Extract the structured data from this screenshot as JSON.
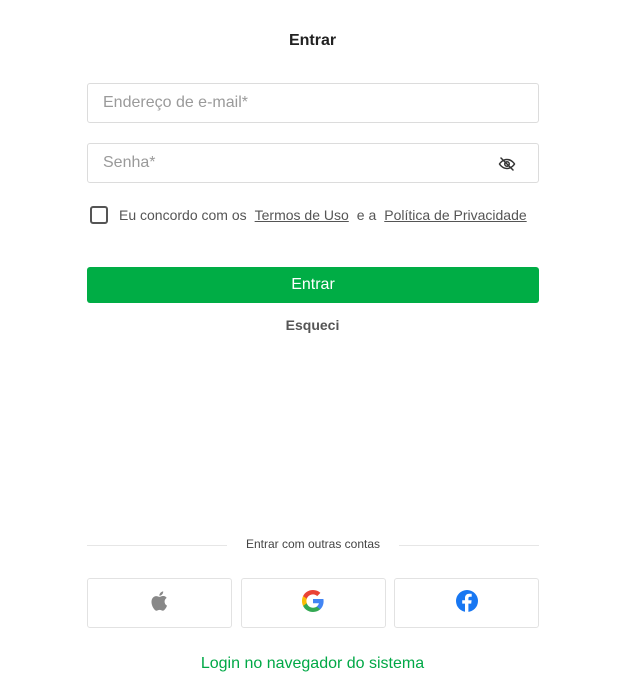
{
  "header": {
    "title": "Entrar"
  },
  "form": {
    "email_placeholder": "Endereço de e-mail*",
    "password_placeholder": "Senha*",
    "agree_prefix": "Eu concordo com os",
    "terms_link": "Termos de Uso",
    "agree_and": "e a",
    "privacy_link": "Política de Privacidade",
    "submit_label": "Entrar",
    "forgot_label": "Esqueci"
  },
  "social": {
    "divider_text": "Entrar com outras contas",
    "providers": [
      "apple-icon",
      "google-icon",
      "facebook-icon"
    ]
  },
  "footer": {
    "system_login": "Login no navegador do sistema"
  },
  "colors": {
    "primary": "#00ad45",
    "link_green": "#00a846",
    "facebook": "#1877f2"
  }
}
